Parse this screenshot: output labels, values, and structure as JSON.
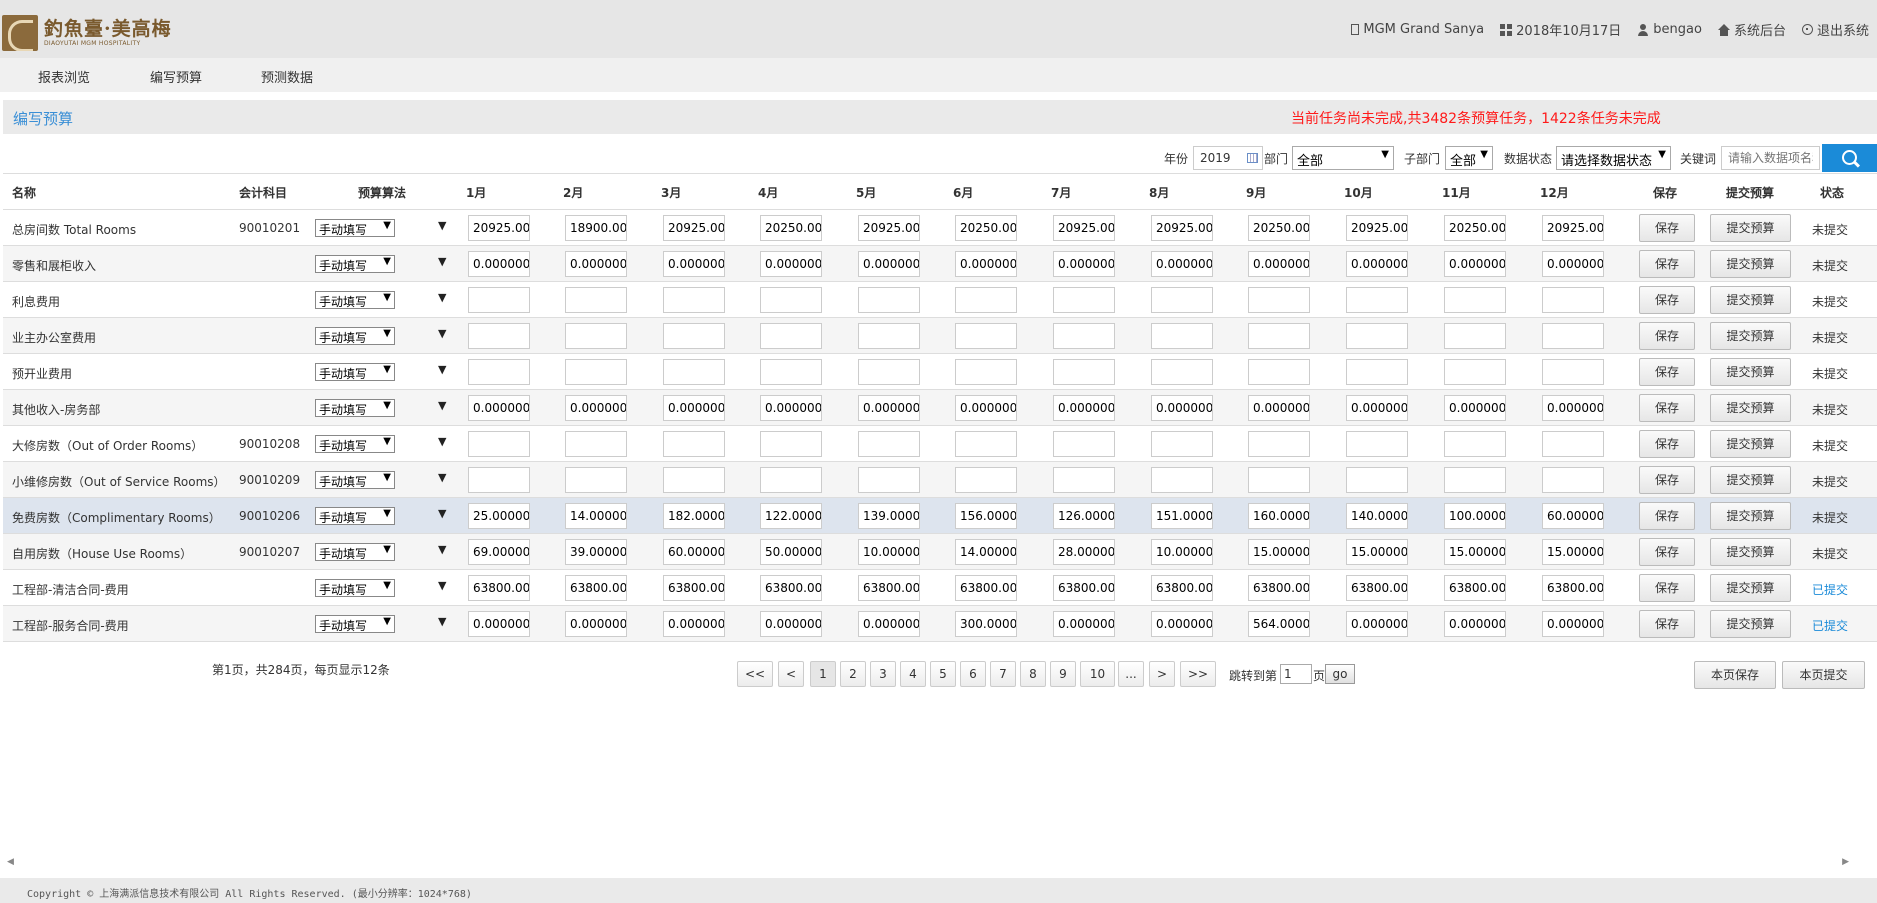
{
  "header": {
    "logo_cn": "釣魚臺·美高梅",
    "logo_en": "DIAOYUTAI MGM HOSPITALITY",
    "hotel": "MGM Grand Sanya",
    "date": "2018年10月17日",
    "user": "bengao",
    "admin": "系统后台",
    "logout": "退出系统"
  },
  "nav": {
    "tabs": [
      "报表浏览",
      "编写预算",
      "预测数据"
    ]
  },
  "page": {
    "title": "编写预算",
    "warning": "当前任务尚未完成,共3482条预算任务，1422条任务未完成"
  },
  "filters": {
    "year_label": "年份",
    "year_value": "2019",
    "dept_label": "部门",
    "dept_value": "全部",
    "subdept_label": "子部门",
    "subdept_value": "全部",
    "status_label": "数据状态",
    "status_value": "请选择数据状态",
    "keyword_label": "关键词",
    "keyword_placeholder": "请输入数据项名称"
  },
  "table": {
    "headers": {
      "name": "名称",
      "code": "会计科目",
      "alg": "预算算法",
      "months": [
        "1月",
        "2月",
        "3月",
        "4月",
        "5月",
        "6月",
        "7月",
        "8月",
        "9月",
        "10月",
        "11月",
        "12月"
      ],
      "save": "保存",
      "submit": "提交预算",
      "status": "状态"
    },
    "row_alg": "手动填写",
    "save_label": "保存",
    "submit_label": "提交预算",
    "rows": [
      {
        "name": "总房间数 Total Rooms",
        "code": "90010201",
        "values": [
          "20925.00",
          "18900.00",
          "20925.00",
          "20250.00",
          "20925.00",
          "20250.00",
          "20925.00",
          "20925.00",
          "20250.00",
          "20925.00",
          "20250.00",
          "20925.00"
        ],
        "status": "未提交"
      },
      {
        "name": "零售和展柜收入",
        "code": "",
        "values": [
          "0.000000",
          "0.000000",
          "0.000000",
          "0.000000",
          "0.000000",
          "0.000000",
          "0.000000",
          "0.000000",
          "0.000000",
          "0.000000",
          "0.000000",
          "0.000000"
        ],
        "status": "未提交"
      },
      {
        "name": "利息费用",
        "code": "",
        "values": [
          "",
          "",
          "",
          "",
          "",
          "",
          "",
          "",
          "",
          "",
          "",
          ""
        ],
        "status": "未提交"
      },
      {
        "name": "业主办公室费用",
        "code": "",
        "values": [
          "",
          "",
          "",
          "",
          "",
          "",
          "",
          "",
          "",
          "",
          "",
          ""
        ],
        "status": "未提交"
      },
      {
        "name": "预开业费用",
        "code": "",
        "values": [
          "",
          "",
          "",
          "",
          "",
          "",
          "",
          "",
          "",
          "",
          "",
          ""
        ],
        "status": "未提交"
      },
      {
        "name": "其他收入-房务部",
        "code": "",
        "values": [
          "0.000000",
          "0.000000",
          "0.000000",
          "0.000000",
          "0.000000",
          "0.000000",
          "0.000000",
          "0.000000",
          "0.000000",
          "0.000000",
          "0.000000",
          "0.000000"
        ],
        "status": "未提交"
      },
      {
        "name": "大修房数（Out of Order Rooms）",
        "code": "90010208",
        "values": [
          "",
          "",
          "",
          "",
          "",
          "",
          "",
          "",
          "",
          "",
          "",
          ""
        ],
        "status": "未提交"
      },
      {
        "name": "小维修房数（Out of Service Rooms）",
        "code": "90010209",
        "values": [
          "",
          "",
          "",
          "",
          "",
          "",
          "",
          "",
          "",
          "",
          "",
          ""
        ],
        "status": "未提交"
      },
      {
        "name": "免费房数（Complimentary Rooms）",
        "code": "90010206",
        "values": [
          "25.00000",
          "14.00000",
          "182.0000",
          "122.0000",
          "139.0000",
          "156.0000",
          "126.0000",
          "151.0000",
          "160.0000",
          "140.0000",
          "100.0000",
          "60.00000"
        ],
        "status": "未提交"
      },
      {
        "name": "自用房数（House Use Rooms）",
        "code": "90010207",
        "values": [
          "69.00000",
          "39.00000",
          "60.00000",
          "50.00000",
          "10.00000",
          "14.00000",
          "28.00000",
          "10.00000",
          "15.00000",
          "15.00000",
          "15.00000",
          "15.00000"
        ],
        "status": "未提交"
      },
      {
        "name": "工程部-清洁合同-费用",
        "code": "",
        "values": [
          "63800.00",
          "63800.00",
          "63800.00",
          "63800.00",
          "63800.00",
          "63800.00",
          "63800.00",
          "63800.00",
          "63800.00",
          "63800.00",
          "63800.00",
          "63800.00"
        ],
        "status": "已提交"
      },
      {
        "name": "工程部-服务合同-费用",
        "code": "",
        "values": [
          "0.000000",
          "0.000000",
          "0.000000",
          "0.000000",
          "0.000000",
          "300.0000",
          "0.000000",
          "0.000000",
          "564.0000",
          "0.000000",
          "0.000000",
          "0.000000"
        ],
        "status": "已提交"
      }
    ]
  },
  "pagination": {
    "info": "第1页，共284页，每页显示12条",
    "buttons": [
      "<<",
      "<",
      "1",
      "2",
      "3",
      "4",
      "5",
      "6",
      "7",
      "8",
      "9",
      "10",
      "...",
      ">",
      ">>"
    ],
    "jump_label": "跳转到第",
    "jump_value": "1",
    "jump_suffix": "页",
    "go": "go",
    "page_save": "本页保存",
    "page_submit": "本页提交"
  },
  "footer": {
    "copyright": "Copyright © 上海满派信息技术有限公司 All Rights Reserved. (最小分辨率：1024*768)"
  }
}
